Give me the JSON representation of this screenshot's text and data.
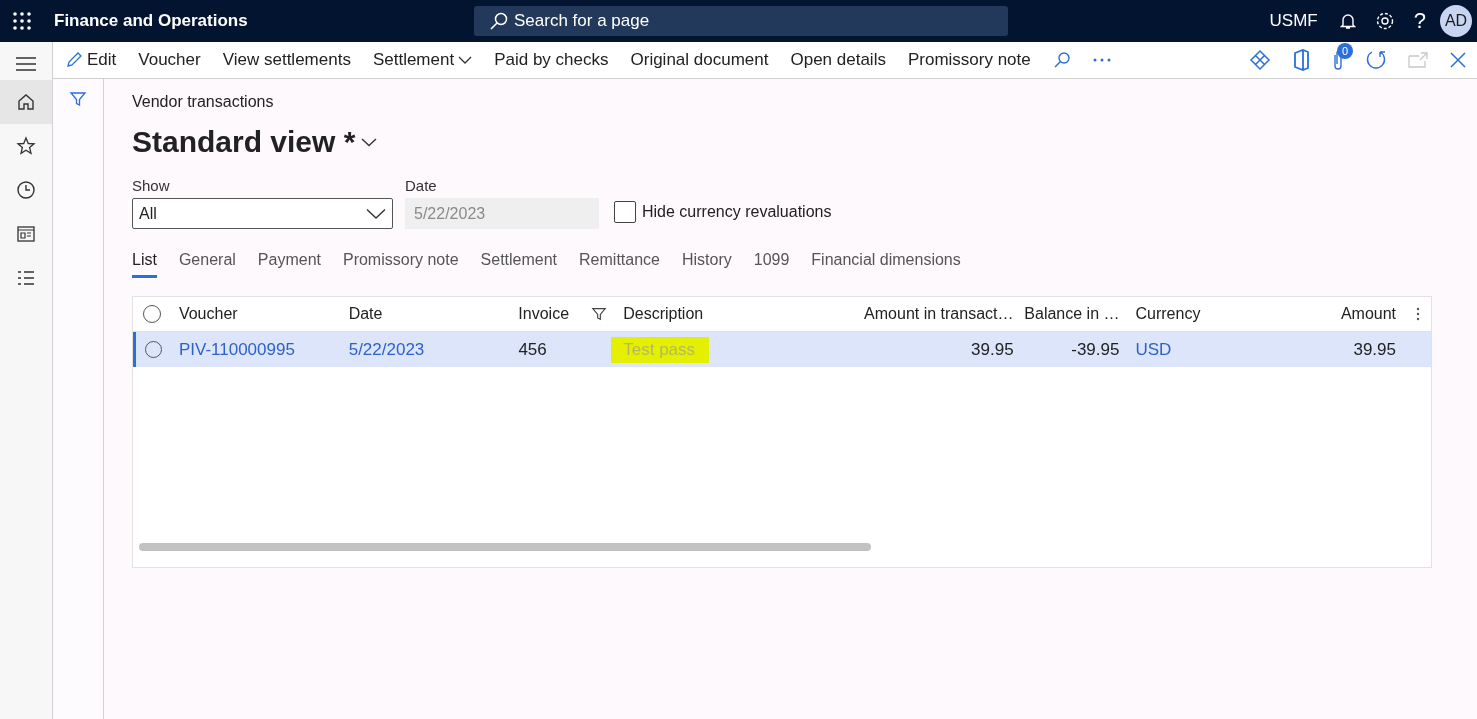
{
  "app_bar": {
    "title": "Finance and Operations",
    "search": {
      "placeholder": "Search for a page"
    },
    "company": "USMF",
    "help": "?",
    "avatar": "AD"
  },
  "left_nav": {
    "items": [
      {
        "selected": true
      },
      {
        "selected": false
      },
      {
        "selected": false
      },
      {
        "selected": false
      },
      {
        "selected": false
      }
    ]
  },
  "action_bar": {
    "items": [
      {
        "label": "Edit",
        "kind": "edit"
      },
      {
        "label": "Voucher",
        "kind": "plain"
      },
      {
        "label": "View settlements",
        "kind": "plain"
      },
      {
        "label": "Settlement",
        "kind": "menu"
      },
      {
        "label": "Paid by checks",
        "kind": "plain"
      },
      {
        "label": "Original document",
        "kind": "plain"
      },
      {
        "label": "Open details",
        "kind": "plain"
      },
      {
        "label": "Promissory note",
        "kind": "plain"
      }
    ],
    "attachments_count": "0"
  },
  "page": {
    "breadcrumb": "Vendor transactions",
    "view_name": "Standard view *"
  },
  "filters": {
    "show": {
      "label": "Show",
      "value": "All"
    },
    "date": {
      "label": "Date",
      "value": "5/22/2023",
      "disabled": true
    },
    "hide_revaluations": {
      "label": "Hide currency revaluations",
      "checked": false
    }
  },
  "tabs": [
    {
      "label": "List",
      "selected": true
    },
    {
      "label": "General",
      "selected": false
    },
    {
      "label": "Payment",
      "selected": false
    },
    {
      "label": "Promissory note",
      "selected": false
    },
    {
      "label": "Settlement",
      "selected": false
    },
    {
      "label": "Remittance",
      "selected": false
    },
    {
      "label": "History",
      "selected": false
    },
    {
      "label": "1099",
      "selected": false
    },
    {
      "label": "Financial dimensions",
      "selected": false
    }
  ],
  "table": {
    "all_selected": false,
    "columns": [
      {
        "label": "Voucher",
        "numeric": false,
        "filtered": false
      },
      {
        "label": "Date",
        "numeric": false,
        "filtered": false
      },
      {
        "label": "Invoice",
        "numeric": false,
        "filtered": true
      },
      {
        "label": "Description",
        "numeric": false,
        "filtered": false
      },
      {
        "label": "Amount in transact…",
        "numeric": true,
        "filtered": false
      },
      {
        "label": "Balance in …",
        "numeric": true,
        "filtered": false
      },
      {
        "label": "Currency",
        "numeric": false,
        "filtered": false
      },
      {
        "label": "Amount",
        "numeric": true,
        "filtered": false
      }
    ],
    "rows": [
      {
        "selected": true,
        "cells": [
          {
            "text": "PIV-110000995",
            "link": true,
            "highlighted": false
          },
          {
            "text": "5/22/2023",
            "link": true,
            "highlighted": false
          },
          {
            "text": "456",
            "link": false,
            "highlighted": false
          },
          {
            "text": "Test pass",
            "link": false,
            "highlighted": true
          },
          {
            "text": "39.95",
            "link": false,
            "highlighted": false
          },
          {
            "text": "-39.95",
            "link": false,
            "highlighted": false
          },
          {
            "text": "USD",
            "link": true,
            "highlighted": false
          },
          {
            "text": "39.95",
            "link": false,
            "highlighted": false
          }
        ]
      }
    ]
  }
}
